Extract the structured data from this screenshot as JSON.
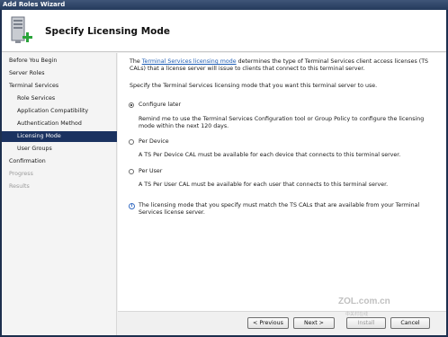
{
  "window": {
    "title": "Add Roles Wizard"
  },
  "header": {
    "title": "Specify Licensing Mode"
  },
  "sidebar": {
    "items": [
      {
        "label": "Before You Begin",
        "level": "top",
        "state": "normal"
      },
      {
        "label": "Server Roles",
        "level": "top",
        "state": "normal"
      },
      {
        "label": "Terminal Services",
        "level": "top",
        "state": "normal"
      },
      {
        "label": "Role Services",
        "level": "sub",
        "state": "normal"
      },
      {
        "label": "Application Compatibility",
        "level": "sub",
        "state": "normal"
      },
      {
        "label": "Authentication Method",
        "level": "sub",
        "state": "normal"
      },
      {
        "label": "Licensing Mode",
        "level": "sub",
        "state": "active"
      },
      {
        "label": "User Groups",
        "level": "sub",
        "state": "normal"
      },
      {
        "label": "Confirmation",
        "level": "top",
        "state": "normal"
      },
      {
        "label": "Progress",
        "level": "top",
        "state": "disabled"
      },
      {
        "label": "Results",
        "level": "top",
        "state": "disabled"
      }
    ]
  },
  "content": {
    "intro_prefix": "The ",
    "intro_link": "Terminal Services licensing mode",
    "intro_suffix": " determines the type of Terminal Services client access licenses (TS CALs) that a license server will issue to clients that connect to this terminal server.",
    "instruction": "Specify the Terminal Services licensing mode that you want this terminal server to use.",
    "options": [
      {
        "label": "Configure later",
        "checked": true,
        "description": "Remind me to use the Terminal Services Configuration tool or Group Policy to configure the licensing mode within the next 120 days."
      },
      {
        "label": "Per Device",
        "checked": false,
        "description": "A TS Per Device CAL must be available for each device that connects to this terminal server."
      },
      {
        "label": "Per User",
        "checked": false,
        "description": "A TS Per User CAL must be available for each user that connects to this terminal server."
      }
    ],
    "info_note": "The licensing mode that you specify must match the TS CALs that are available from your Terminal Services license server."
  },
  "footer": {
    "previous_label": "< Previous",
    "next_label": "Next >",
    "install_label": "Install",
    "cancel_label": "Cancel"
  },
  "watermark": {
    "brand": "ZOL.com.cn",
    "sub": "中关村在线"
  },
  "colors": {
    "active_nav": "#1b3260",
    "link": "#1e5cb3",
    "title_bar": "#243a5c"
  }
}
